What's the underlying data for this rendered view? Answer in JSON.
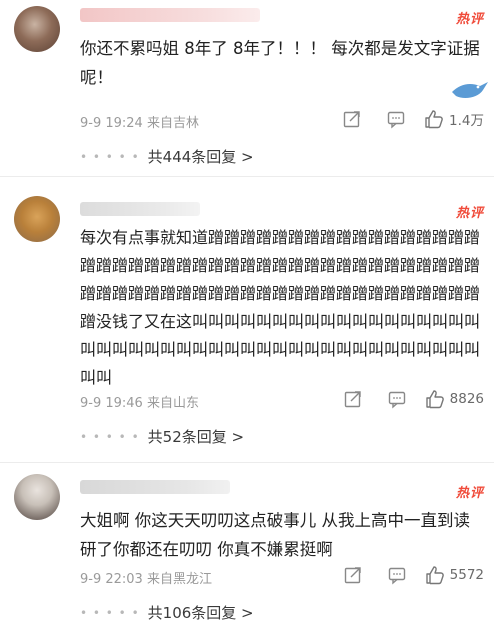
{
  "comments": [
    {
      "hot_badge": "热评",
      "text": "你还不累吗姐 8年了 8年了！！！ 每次都是发文字证据呢！",
      "meta": "9-9 19:24  来自吉林",
      "likes": "1.4万",
      "replies": "共444条回复 >"
    },
    {
      "hot_badge": "热评",
      "text": "每次有点事就知道蹭蹭蹭蹭蹭蹭蹭蹭蹭蹭蹭蹭蹭蹭蹭蹭蹭蹭蹭蹭蹭蹭蹭蹭蹭蹭蹭蹭蹭蹭蹭蹭蹭蹭蹭蹭蹭蹭蹭蹭蹭蹭蹭蹭蹭蹭蹭蹭蹭蹭蹭蹭蹭蹭蹭蹭蹭蹭蹭蹭蹭蹭蹭蹭蹭蹭蹭蹭没钱了又在这叫叫叫叫叫叫叫叫叫叫叫叫叫叫叫叫叫叫叫叫叫叫叫叫叫叫叫叫叫叫叫叫叫叫叫叫叫叫叫叫叫叫叫叫叫",
      "meta": "9-9 19:46  来自山东",
      "likes": "8826",
      "replies": "共52条回复 >"
    },
    {
      "hot_badge": "热评",
      "text": "大姐啊 你这天天叨叨这点破事儿 从我上高中一直到读研了你都还在叨叨 你真不嫌累挺啊",
      "meta": "9-9 22:03  来自黑龙江",
      "likes": "5572",
      "replies": "共106条回复 >"
    }
  ],
  "reply_dots": "• • • • •",
  "icons": {
    "share": "share-icon",
    "comment": "comment-icon",
    "like": "thumbs-up-icon"
  },
  "colors": {
    "hot_badge": "#f04b3a",
    "meta": "#9a9a9a",
    "divider": "#ececec"
  }
}
